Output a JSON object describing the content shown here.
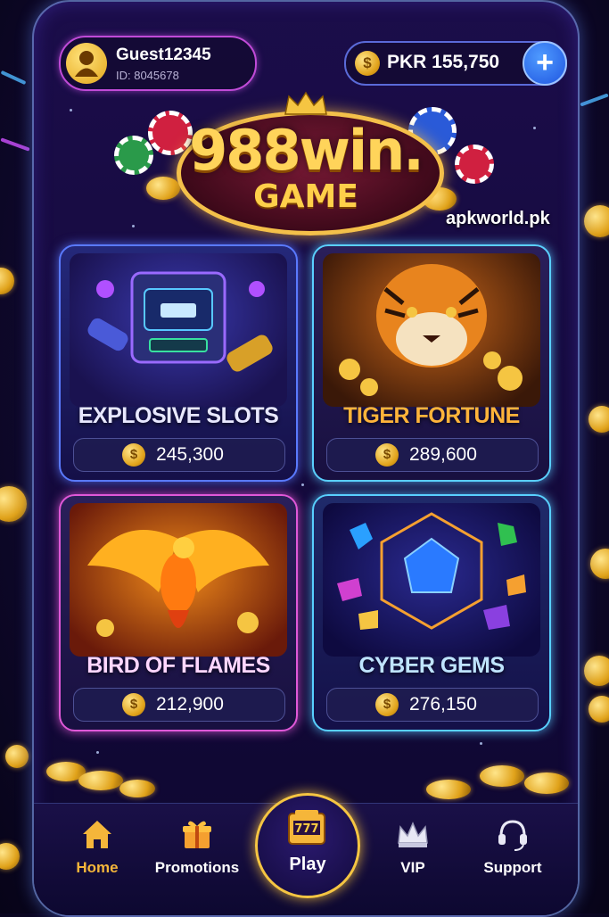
{
  "header": {
    "username": "Guest12345",
    "user_id": "ID: 8045678",
    "balance": "PKR 155,750",
    "coin_symbol": "$",
    "add_symbol": "+"
  },
  "logo": {
    "main": "988win.",
    "sub": "GAME"
  },
  "watermark": "apkworld.pk",
  "games": [
    {
      "title": "EXPLOSIVE SLOTS",
      "value": "245,300",
      "title_color": "#e8e8ff"
    },
    {
      "title": "TIGER FORTUNE",
      "value": "289,600",
      "title_color": "#ffb43a"
    },
    {
      "title": "BIRD OF FLAMES",
      "value": "212,900",
      "title_color": "#ffd7ff"
    },
    {
      "title": "CYBER GEMS",
      "value": "276,150",
      "title_color": "#bfe4ff"
    }
  ],
  "nav": {
    "home": "Home",
    "promotions": "Promotions",
    "play": "Play",
    "vip": "VIP",
    "support": "Support"
  },
  "colors": {
    "accent_gold": "#f5c542",
    "home_active": "#f5b63a",
    "add_button": "#1f55e0"
  }
}
